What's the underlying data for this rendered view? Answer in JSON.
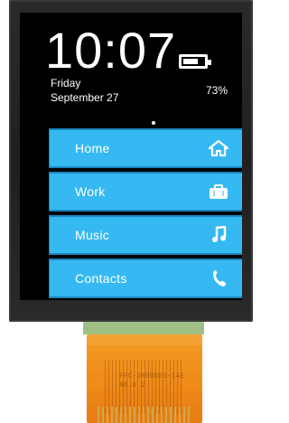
{
  "status": {
    "time": "10:07",
    "day": "Friday",
    "date": "September 27",
    "battery_percent": "73%",
    "battery_level": 0.73
  },
  "menu": {
    "items": [
      {
        "label": "Home",
        "icon": "home-icon"
      },
      {
        "label": "Work",
        "icon": "briefcase-icon"
      },
      {
        "label": "Music",
        "icon": "music-note-icon"
      },
      {
        "label": "Contacts",
        "icon": "phone-icon"
      }
    ]
  },
  "colors": {
    "tile": "#36b9f2",
    "tile_border": "#1a86bf",
    "screen": "#000000",
    "fpc": "#f08b19"
  },
  "fpc": {
    "label_line1": "FPC-2R0BN03-14E",
    "label_line2": "N8.0 2"
  }
}
